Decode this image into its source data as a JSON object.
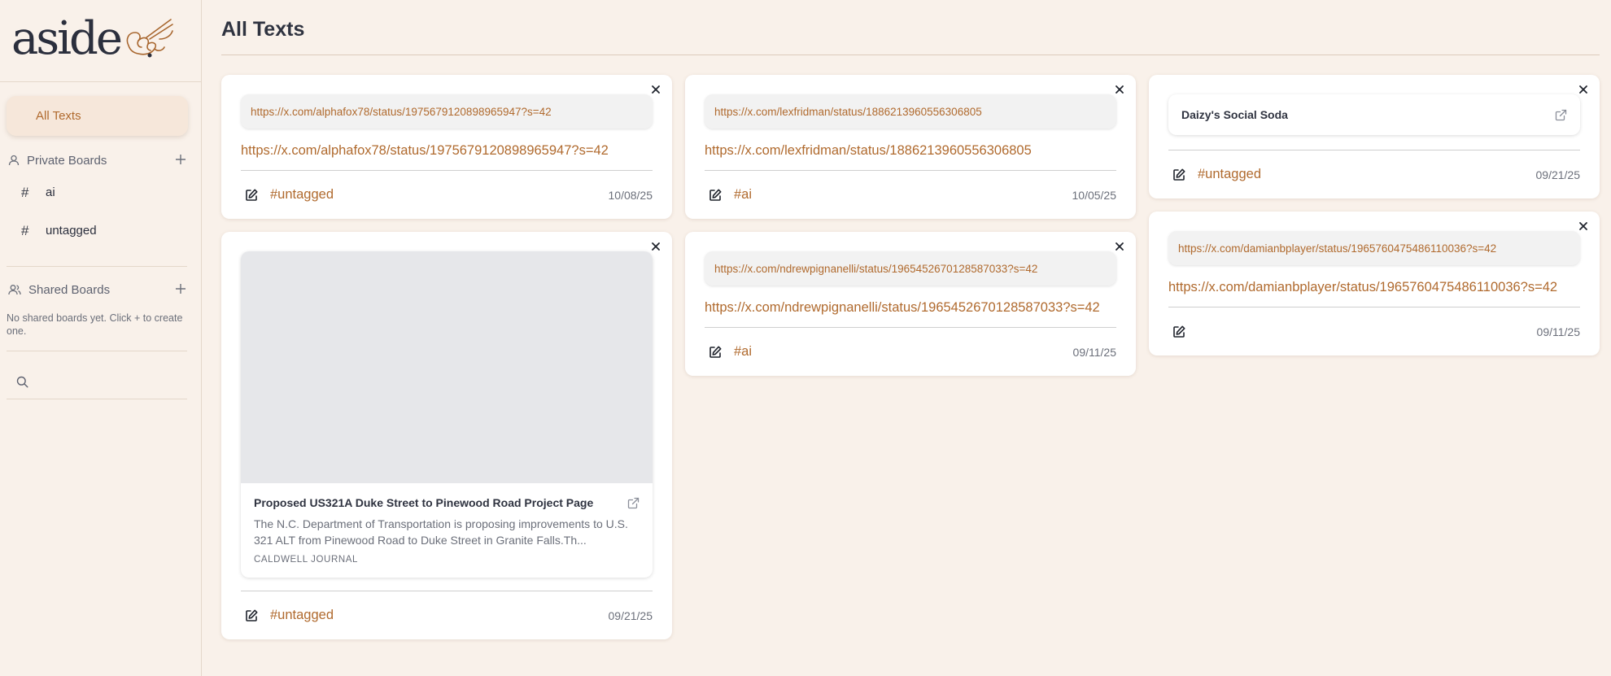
{
  "brand": {
    "name": "aside"
  },
  "sidebar": {
    "all_texts": "All Texts",
    "private_boards": {
      "label": "Private Boards",
      "items": [
        {
          "label": "ai"
        },
        {
          "label": "untagged"
        }
      ]
    },
    "shared_boards": {
      "label": "Shared Boards",
      "empty": "No shared boards yet. Click + to create one."
    }
  },
  "main": {
    "title": "All Texts",
    "cards": {
      "c1": {
        "pill": "https://x.com/alphafox78/status/1975679120898965947?s=42",
        "text": "https://x.com/alphafox78/status/1975679120898965947?s=42",
        "tag": "#untagged",
        "date": "10/08/25"
      },
      "c2": {
        "preview_title": "Proposed US321A Duke Street to Pinewood Road Project Page",
        "preview_desc": "The N.C. Department of Transportation is proposing improvements to U.S. 321 ALT from Pinewood Road to Duke Street in Granite Falls.Th...",
        "preview_source": "CALDWELL JOURNAL",
        "tag": "#untagged",
        "date": "09/21/25"
      },
      "c3": {
        "pill": "https://x.com/lexfridman/status/1886213960556306805",
        "text": "https://x.com/lexfridman/status/1886213960556306805",
        "tag": "#ai",
        "date": "10/05/25"
      },
      "c4": {
        "pill": "https://x.com/ndrewpignanelli/status/1965452670128587033?s=42",
        "text": "https://x.com/ndrewpignanelli/status/1965452670128587033?s=42",
        "tag": "#ai",
        "date": "09/11/25"
      },
      "c5": {
        "link_title": "Daizy's Social Soda",
        "tag": "#untagged",
        "date": "09/21/25"
      },
      "c6": {
        "pill": "https://x.com/damianbplayer/status/1965760475486110036?s=42",
        "text": "https://x.com/damianbplayer/status/1965760475486110036?s=42",
        "date": "09/11/25"
      }
    }
  },
  "colors": {
    "background": "#f9f1ea",
    "accent": "#b06a2e",
    "active_nav": "#f6e7da",
    "card": "#ffffff"
  },
  "icons": [
    "logo-hand-icon",
    "user-icon",
    "users-icon",
    "plus-icon",
    "hash-icon",
    "search-icon",
    "close-icon",
    "edit-icon",
    "external-link-icon"
  ]
}
